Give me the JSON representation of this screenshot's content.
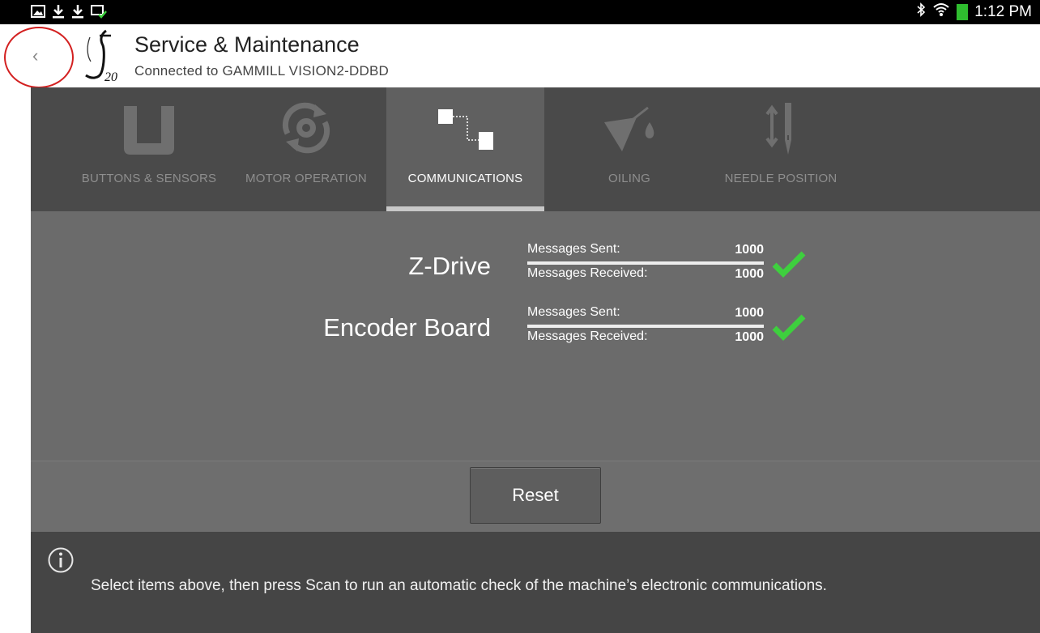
{
  "status_bar": {
    "time": "1:12 PM",
    "left_icons": [
      "image-notification-icon",
      "download-icon",
      "download-icon",
      "device-check-icon"
    ],
    "right_icons": [
      "bluetooth-icon",
      "wifi-icon",
      "battery-icon"
    ]
  },
  "header": {
    "title": "Service & Maintenance",
    "subtitle": "Connected to GAMMILL VISION2-DDBD",
    "logo_text": "20",
    "back_glyph": "‹"
  },
  "tabs": [
    {
      "label": "BUTTONS & SENSORS",
      "icon": "buttons-sensors-icon",
      "active": false
    },
    {
      "label": "MOTOR OPERATION",
      "icon": "motor-operation-icon",
      "active": false
    },
    {
      "label": "COMMUNICATIONS",
      "icon": "communications-icon",
      "active": true
    },
    {
      "label": "OILING",
      "icon": "oiling-icon",
      "active": false
    },
    {
      "label": "NEEDLE POSITION",
      "icon": "needle-position-icon",
      "active": false
    }
  ],
  "devices": [
    {
      "name": "Z-Drive",
      "sent_label": "Messages Sent:",
      "sent": "1000",
      "received_label": "Messages Received:",
      "received": "1000",
      "status": "ok"
    },
    {
      "name": "Encoder Board",
      "sent_label": "Messages Sent:",
      "sent": "1000",
      "received_label": "Messages Received:",
      "received": "1000",
      "status": "ok"
    }
  ],
  "actions": {
    "reset_label": "Reset"
  },
  "info": {
    "text": "Select items above, then press Scan to run an automatic check of the machine’s electronic communications."
  },
  "colors": {
    "check": "#3ecf3e",
    "tab_bar": "#4a4a4a",
    "tab_active": "#606060",
    "panel": "#6b6b6b",
    "footer": "#454545",
    "highlight_circle": "#d32020"
  }
}
